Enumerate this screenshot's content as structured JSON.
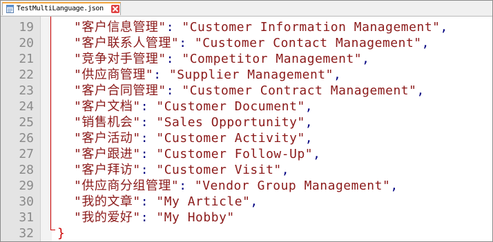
{
  "tab": {
    "title": "TestMultiLanguage.json",
    "icon": "file-icon",
    "close_icon": "close-icon"
  },
  "colors": {
    "string": "#8b1a1a",
    "punctuation": "#000080",
    "brace": "#cc0000",
    "line_number": "#8a8a8a",
    "tab_accent": "#f2a640",
    "close_button": "#e04343"
  },
  "lines": [
    {
      "num": "19",
      "key": "\"客户信息管理\"",
      "sep": ": ",
      "value": "\"Customer Information Management\"",
      "end": ","
    },
    {
      "num": "20",
      "key": "\"客户联系人管理\"",
      "sep": ": ",
      "value": "\"Customer Contact Management\"",
      "end": ","
    },
    {
      "num": "21",
      "key": "\"竞争对手管理\"",
      "sep": ": ",
      "value": "\"Competitor Management\"",
      "end": ","
    },
    {
      "num": "22",
      "key": "\"供应商管理\"",
      "sep": ": ",
      "value": "\"Supplier Management\"",
      "end": ","
    },
    {
      "num": "23",
      "key": "\"客户合同管理\"",
      "sep": ": ",
      "value": "\"Customer Contract Management\"",
      "end": ","
    },
    {
      "num": "24",
      "key": "\"客户文档\"",
      "sep": ": ",
      "value": "\"Customer Document\"",
      "end": ","
    },
    {
      "num": "25",
      "key": "\"销售机会\"",
      "sep": ": ",
      "value": "\"Sales Opportunity\"",
      "end": ","
    },
    {
      "num": "26",
      "key": "\"客户活动\"",
      "sep": ": ",
      "value": "\"Customer Activity\"",
      "end": ","
    },
    {
      "num": "27",
      "key": "\"客户跟进\"",
      "sep": ": ",
      "value": "\"Customer Follow-Up\"",
      "end": ","
    },
    {
      "num": "28",
      "key": "\"客户拜访\"",
      "sep": ": ",
      "value": "\"Customer Visit\"",
      "end": ","
    },
    {
      "num": "29",
      "key": "\"供应商分组管理\"",
      "sep": ": ",
      "value": "\"Vendor Group Management\"",
      "end": ","
    },
    {
      "num": "30",
      "key": "\"我的文章\"",
      "sep": ": ",
      "value": "\"My Article\"",
      "end": ","
    },
    {
      "num": "31",
      "key": "\"我的爱好\"",
      "sep": ": ",
      "value": "\"My Hobby\"",
      "end": ""
    }
  ],
  "closing": {
    "num": "32",
    "text": "}"
  }
}
